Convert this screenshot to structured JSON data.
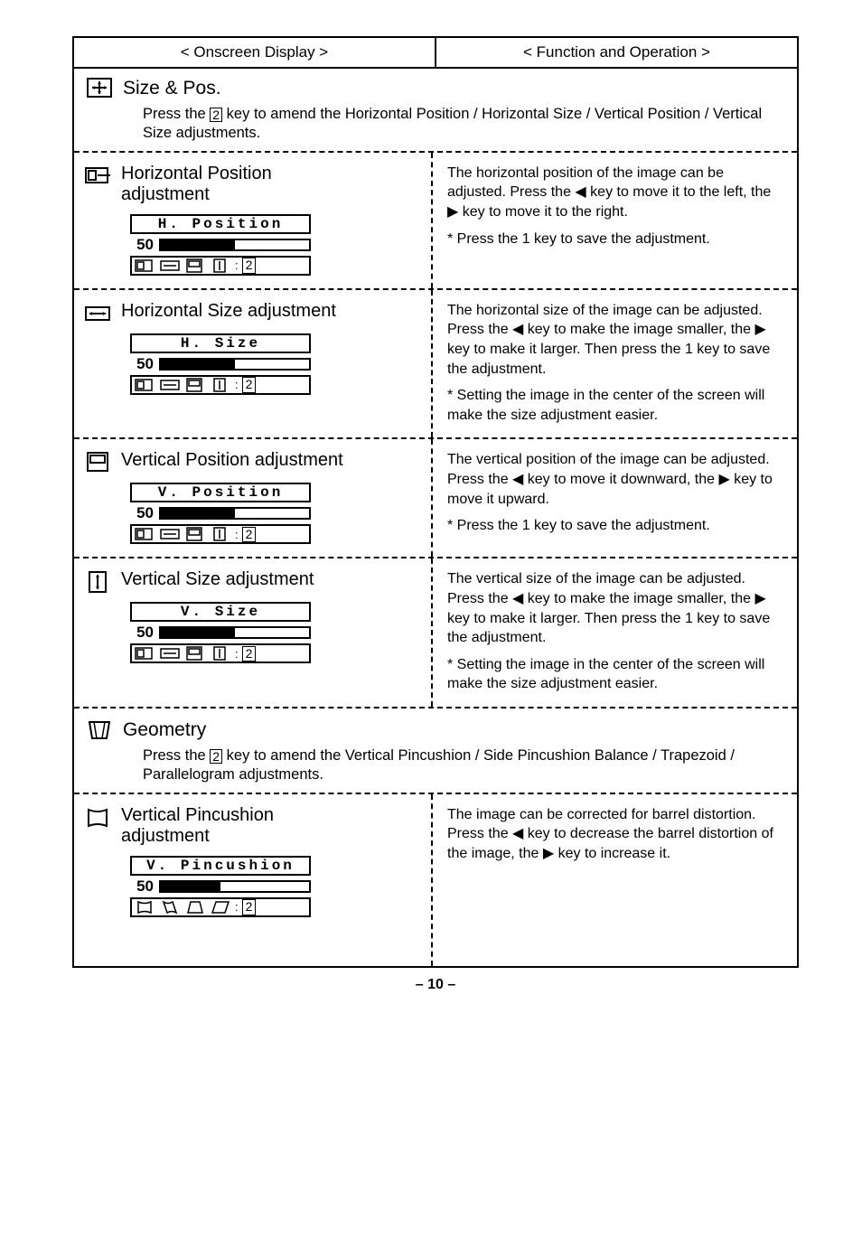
{
  "headers": {
    "left": "< Onscreen Display >",
    "right": "< Function and Operation >"
  },
  "keys": {
    "k1": "1",
    "k2": "2"
  },
  "pageNumber": "– 10 –",
  "sections": [
    {
      "id": "sizepos",
      "icon": "size-pos-icon",
      "title": "Size & Pos.",
      "desc_pre": "Press the ",
      "desc_key": "2",
      "desc_post": " key to amend the Horizontal Position / Horizontal Size / Vertical Position / Vertical Size adjustments.",
      "rows": [
        {
          "id": "hpos",
          "icon": "hpos-icon",
          "title": "Horizontal Position adjustment",
          "osd": {
            "label": "H. Position",
            "value": "50",
            "fill": 50,
            "footer_icons": "pos"
          },
          "desc": "The horizontal position of the image can be adjusted. Press the ◀ key to move it to the left, the ▶ key to move it to the right.",
          "note": "* Press the 1 key to save the adjustment."
        },
        {
          "id": "hsize",
          "icon": "hsize-icon",
          "title": "Horizontal Size adjustment",
          "osd": {
            "label": "H. Size",
            "value": "50",
            "fill": 50,
            "footer_icons": "pos"
          },
          "desc": "The horizontal size of the image can be adjusted. Press the ◀ key to make the image smaller, the ▶ key to make it larger. Then press the 1 key to save the adjustment.",
          "note": "* Setting the image in the center of the screen will make the size adjustment easier."
        },
        {
          "id": "vpos",
          "icon": "vpos-icon",
          "title": "Vertical Position adjustment",
          "osd": {
            "label": "V. Position",
            "value": "50",
            "fill": 50,
            "footer_icons": "pos"
          },
          "desc": "The vertical position of the image can be adjusted. Press the ◀ key to move it downward, the ▶ key to move it upward.",
          "note": "* Press the 1 key to save the adjustment."
        },
        {
          "id": "vsize",
          "icon": "vsize-icon",
          "title": "Vertical Size adjustment",
          "osd": {
            "label": "V. Size",
            "value": "50",
            "fill": 50,
            "footer_icons": "pos"
          },
          "desc": "The vertical size of the image can be adjusted. Press the ◀ key to make the image smaller, the ▶ key to make it larger. Then press the 1 key to save the adjustment.",
          "note": "* Setting the image in the center of the screen will make the size adjustment easier."
        }
      ]
    },
    {
      "id": "geometry",
      "icon": "geometry-icon",
      "title": "Geometry",
      "desc_pre": "Press the ",
      "desc_key": "2",
      "desc_post": " key to amend the Vertical Pincushion / Side Pincushion Balance / Trapezoid / Parallelogram adjustments.",
      "rows": [
        {
          "id": "vpin",
          "icon": "vpin-icon",
          "title": "Vertical Pincushion adjustment",
          "osd": {
            "label": "V. Pincushion",
            "value": "50",
            "fill": 40,
            "footer_icons": "geom"
          },
          "desc": "The image can be corrected for barrel distortion. Press the ◀ key to decrease the barrel distortion of the image, the ▶ key to increase it.",
          "note": ""
        }
      ]
    }
  ]
}
